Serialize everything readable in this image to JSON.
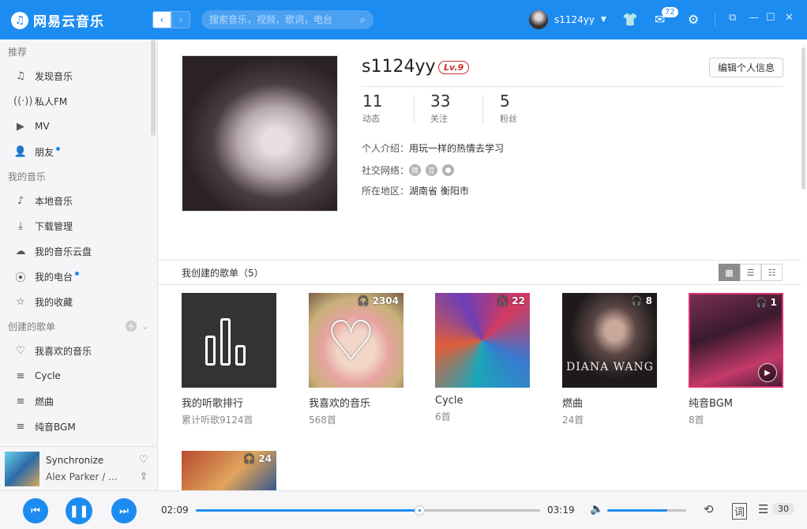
{
  "header": {
    "app_name": "网易云音乐",
    "search_placeholder": "搜索音乐，视频，歌词，电台",
    "username": "s1124yy",
    "messages_count": "72",
    "nav_back": "‹",
    "nav_forward": "›"
  },
  "sidebar": {
    "section_recommend": "推荐",
    "recommend_items": [
      "发现音乐",
      "私人FM",
      "MV",
      "朋友"
    ],
    "section_my_music": "我的音乐",
    "my_music_items": [
      "本地音乐",
      "下载管理",
      "我的音乐云盘",
      "我的电台",
      "我的收藏"
    ],
    "section_created": "创建的歌单",
    "created_items": [
      "我喜欢的音乐",
      "Cycle",
      "燃曲",
      "纯音BGM"
    ]
  },
  "mini_player": {
    "title": "Synchronize",
    "artist": "Alex Parker / ..."
  },
  "profile": {
    "name": "s1124yy",
    "level": "Lv.9",
    "edit_button": "编辑个人信息",
    "stats": [
      {
        "value": "11",
        "label": "动态"
      },
      {
        "value": "33",
        "label": "关注"
      },
      {
        "value": "5",
        "label": "粉丝"
      }
    ],
    "intro_label": "个人介绍：",
    "intro_value": "用玩一样的热情去学习",
    "social_label": "社交网络：",
    "social_icons": [
      "weibo-icon",
      "douban-icon",
      "github-icon"
    ],
    "region_label": "所在地区：",
    "region_value": "湖南省 衡阳市"
  },
  "playlists_section": {
    "title": "我创建的歌单（5）",
    "items": [
      {
        "name": "我的听歌排行",
        "sub": "累计听歌9124首",
        "count": ""
      },
      {
        "name": "我喜欢的音乐",
        "sub": "568首",
        "count": "2304"
      },
      {
        "name": "Cycle",
        "sub": "6首",
        "count": "22"
      },
      {
        "name": "燃曲",
        "sub": "24首",
        "count": "8"
      },
      {
        "name": "纯音BGM",
        "sub": "8首",
        "count": "1"
      },
      {
        "name": "",
        "sub": "",
        "count": "24"
      }
    ],
    "cover_text_diana": "DIANA WANG"
  },
  "player": {
    "current_time": "02:09",
    "total_time": "03:19",
    "progress_pct": 65,
    "volume_pct": 76,
    "queue_count": "30",
    "lyrics_label": "词"
  },
  "colors": {
    "accent": "#1c8cf0",
    "level_red": "#c62f2f"
  }
}
